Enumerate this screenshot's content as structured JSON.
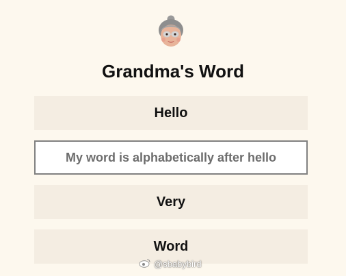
{
  "header": {
    "avatar_icon": "grandma-emoji-icon",
    "title": "Grandma's Word"
  },
  "rows": [
    {
      "label": "Hello"
    },
    {
      "placeholder": "My word is alphabetically after hello",
      "value": ""
    },
    {
      "label": "Very"
    },
    {
      "label": "Word"
    }
  ],
  "watermark": {
    "icon": "weibo-icon",
    "text": "@sbabybird"
  },
  "colors": {
    "background": "#fdf8ee",
    "row_background": "#f4ede2",
    "input_border": "#808080",
    "text": "#111111",
    "placeholder_text": "#6d6d6d"
  }
}
